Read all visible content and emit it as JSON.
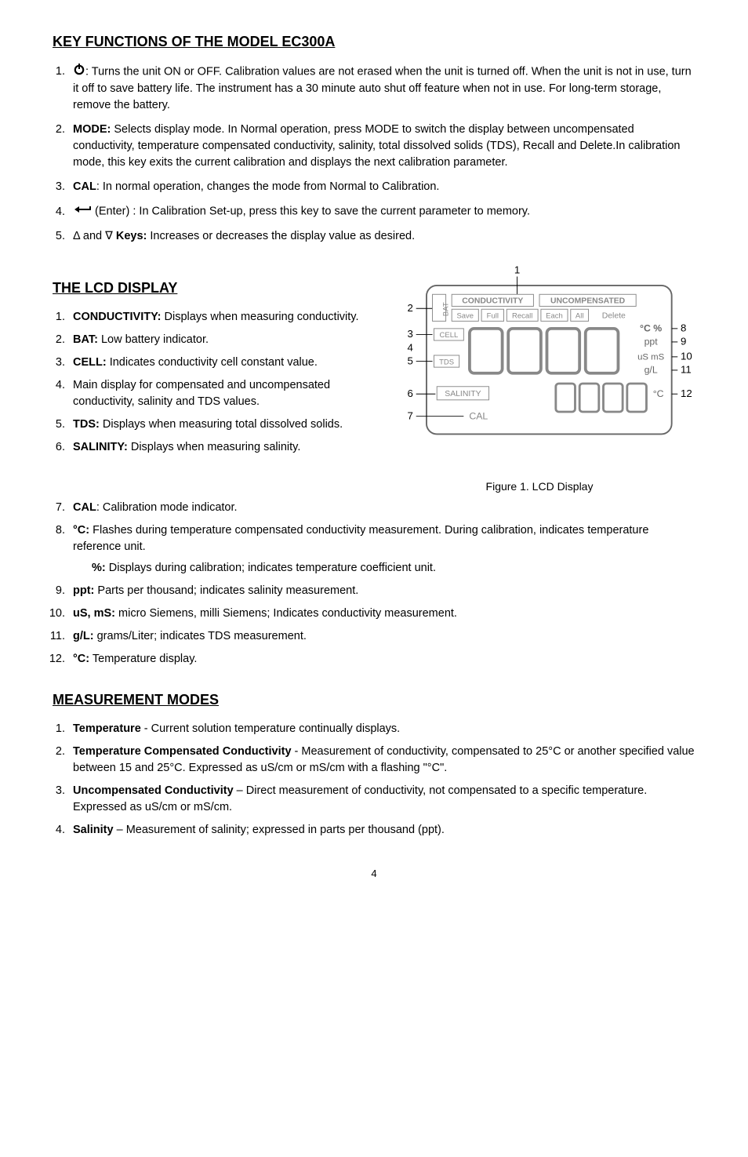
{
  "sections": {
    "key_functions": {
      "title": "KEY FUNCTIONS OF THE MODEL EC300A",
      "items": [
        {
          "lead": "",
          "text": ": Turns the unit ON or OFF.  Calibration values are not erased when the unit is turned off.  When the unit is not in use, turn it off to save battery life. The instrument has a 30 minute auto shut off feature when not in use. For long-term storage, remove the battery."
        },
        {
          "lead": "MODE:",
          "text": " Selects display mode. In Normal operation, press MODE to switch the display between uncompensated conductivity, temperature compensated conductivity, salinity, total dissolved solids (TDS), Recall and Delete.In calibration mode, this key exits the current calibration and displays the next calibration parameter."
        },
        {
          "lead": "CAL",
          "text": ": In normal operation, changes the mode from Normal to Calibration."
        },
        {
          "lead": "",
          "text": " (Enter) : In Calibration Set-up, press this key to save the current parameter to memory."
        },
        {
          "lead": "Keys:",
          "pre": "Δ and ∇ ",
          "text": " Increases or decreases the display value as desired."
        }
      ]
    },
    "lcd_display": {
      "title": "THE LCD DISPLAY",
      "items_left": [
        {
          "lead": "CONDUCTIVITY:",
          "text": " Displays when measuring conductivity."
        },
        {
          "lead": "BAT:",
          "text": " Low battery indicator."
        },
        {
          "lead": "CELL:",
          "text": " Indicates conductivity cell constant value."
        },
        {
          "lead": "",
          "text": "Main display for compensated and uncompensated conductivity, salinity and TDS values."
        },
        {
          "lead": "TDS:",
          "text": " Displays when measuring total dissolved solids."
        },
        {
          "lead": " SALINITY:",
          "text": " Displays when measuring salinity."
        }
      ],
      "items_bottom": [
        {
          "lead": "CAL",
          "text": ": Calibration mode indicator."
        },
        {
          "lead": "°C:",
          "text": " Flashes during temperature compensated conductivity measurement.  During calibration, indicates temperature reference unit.",
          "sub_lead": "%:",
          "sub_text": " Displays during calibration; indicates temperature coefficient unit."
        },
        {
          "lead": "ppt:",
          "text": " Parts per thousand; indicates salinity measurement."
        },
        {
          "lead": "uS, mS:",
          "text": " micro Siemens, milli Siemens; Indicates conductivity measurement."
        },
        {
          "lead": "g/L:",
          "text": " grams/Liter; indicates TDS measurement."
        },
        {
          "lead": "°C:",
          "text": " Temperature display."
        }
      ],
      "figure_caption": "Figure 1.  LCD Display",
      "lcd_labels": {
        "n1": "1",
        "n2": "2",
        "n3": "3",
        "n4": "4",
        "n5": "5",
        "n6": "6",
        "n7": "7",
        "n8": "8",
        "n9": "9",
        "n10": "10",
        "n11": "11",
        "n12": "12",
        "conductivity": "CONDUCTIVITY",
        "uncompensated": "UNCOMPENSATED",
        "save": "Save",
        "full": "Full",
        "recall": "Recall",
        "each": "Each",
        "all": "All",
        "delete": "Delete",
        "cell": "CELL",
        "tds": "TDS",
        "salinity": "SALINITY",
        "cal": "CAL",
        "degc_pct": "°C %",
        "ppt": "ppt",
        "us_ms": "uS mS",
        "gl": "g/L",
        "degc": "°C",
        "bat": "BAT"
      }
    },
    "measurement_modes": {
      "title": "MEASUREMENT MODES",
      "items": [
        {
          "lead": "Temperature",
          "text": " - Current solution temperature continually displays."
        },
        {
          "lead": "Temperature Compensated Conductivity",
          "text": " - Measurement of conductivity, compensated to 25°C or another specified value between 15 and 25°C.  Expressed as uS/cm or mS/cm with a flashing \"°C\"."
        },
        {
          "lead": "Uncompensated Conductivity",
          "text": " – Direct measurement of conductivity, not compensated to a specific temperature.  Expressed as uS/cm or mS/cm."
        },
        {
          "lead": "Salinity",
          "text": " – Measurement of salinity; expressed in parts per thousand (ppt)."
        }
      ]
    }
  },
  "page_number": "4"
}
